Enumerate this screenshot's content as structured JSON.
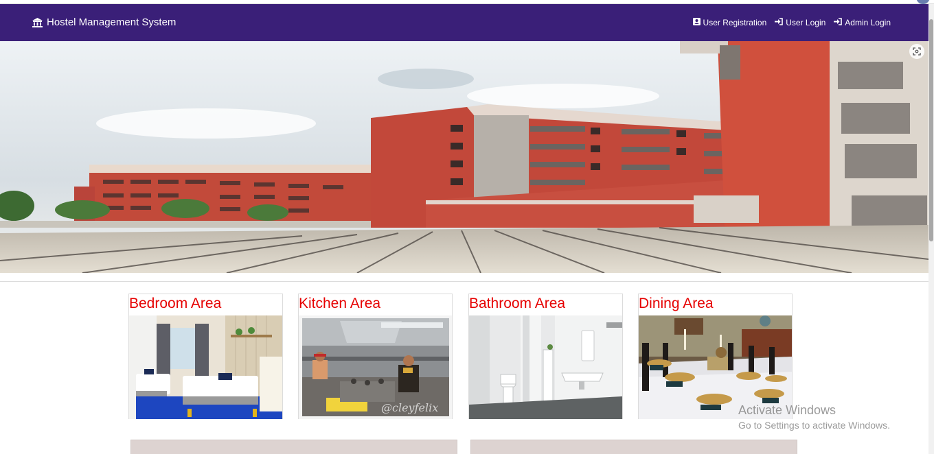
{
  "navbar": {
    "brand": "Hostel Management System",
    "brand_icon": "institution-icon",
    "background": "#3a1f78",
    "links": [
      {
        "label": "User Registration",
        "icon": "address-card-icon"
      },
      {
        "label": "User Login",
        "icon": "sign-in-icon"
      },
      {
        "label": "Admin Login",
        "icon": "sign-in-icon"
      }
    ]
  },
  "hero": {
    "subject": "hostel buildings",
    "zoom_icon": "zoom-icon"
  },
  "cards": [
    {
      "title": "Bedroom Area"
    },
    {
      "title": "Kitchen Area"
    },
    {
      "title": "Bathroom Area"
    },
    {
      "title": "Dining Area"
    }
  ],
  "card_title_color": "#e60000",
  "watermark": {
    "line1": "Activate Windows",
    "line2": "Go to Settings to activate Windows."
  }
}
